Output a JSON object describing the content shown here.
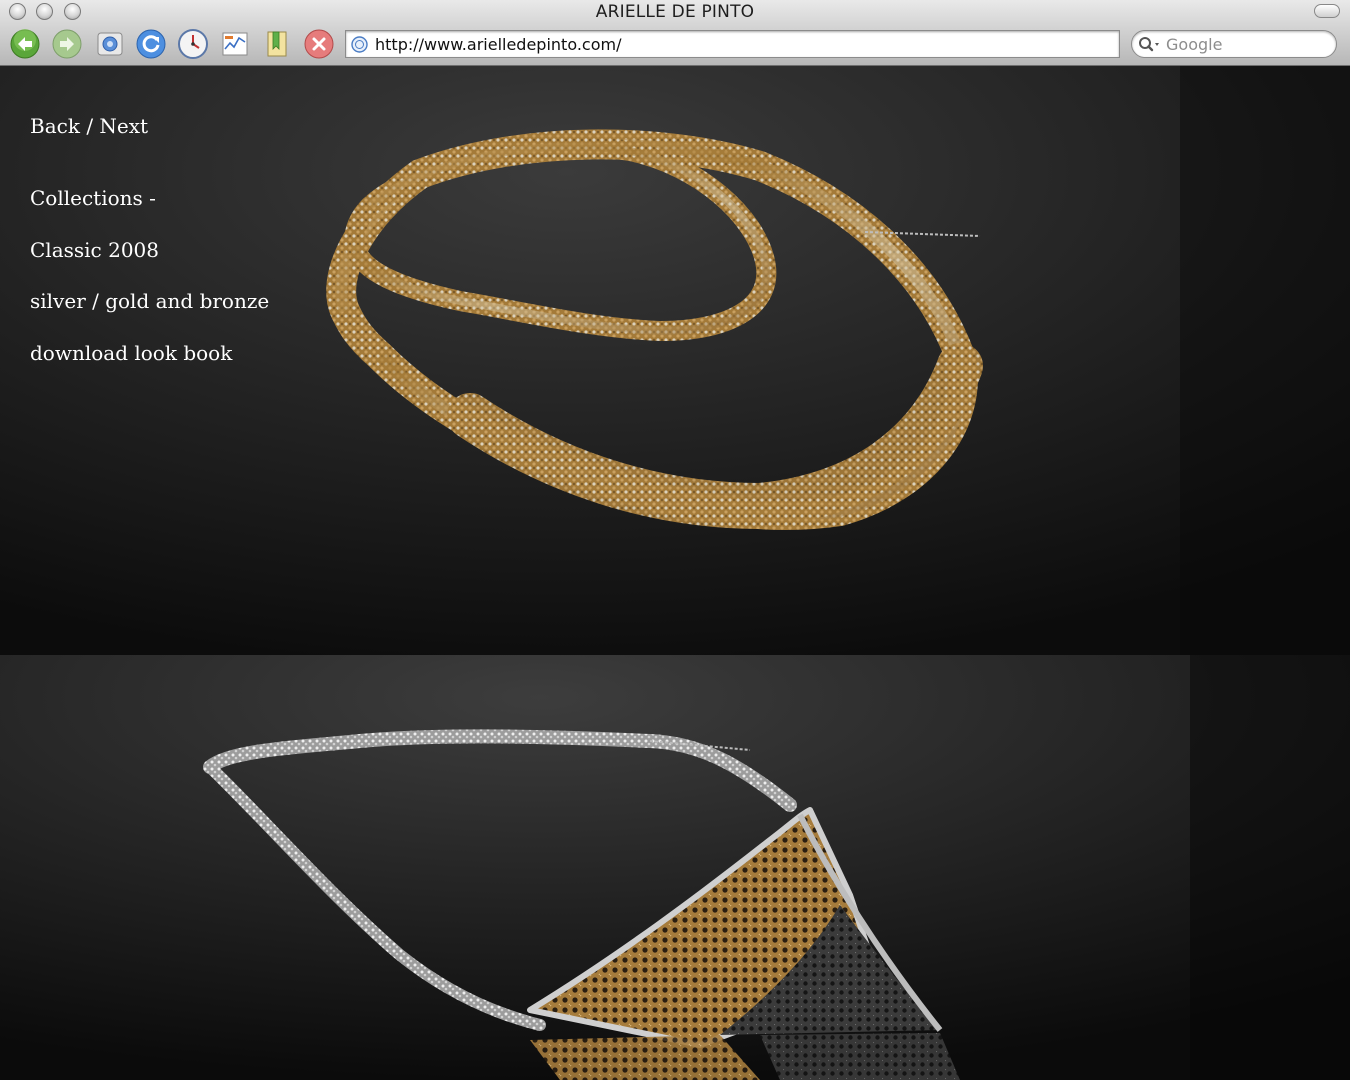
{
  "window": {
    "title": "ARIELLE DE PINTO"
  },
  "toolbar": {
    "back_icon": "back-arrow-icon",
    "forward_icon": "forward-arrow-icon",
    "url": "http://www.arielledepinto.com/",
    "search_placeholder": "Google"
  },
  "nav": {
    "back_label": "Back",
    "separator": "/",
    "next_label": "Next",
    "collections_label": "Collections -",
    "collection_name": "Classic 2008",
    "materials": "silver / gold and bronze",
    "lookbook_label": "download look book"
  },
  "colors": {
    "background": "#141414",
    "text": "#ffffff",
    "gold": "#b8893f",
    "silver": "#cfcfcf",
    "gunmetal": "#3a3a3a"
  }
}
